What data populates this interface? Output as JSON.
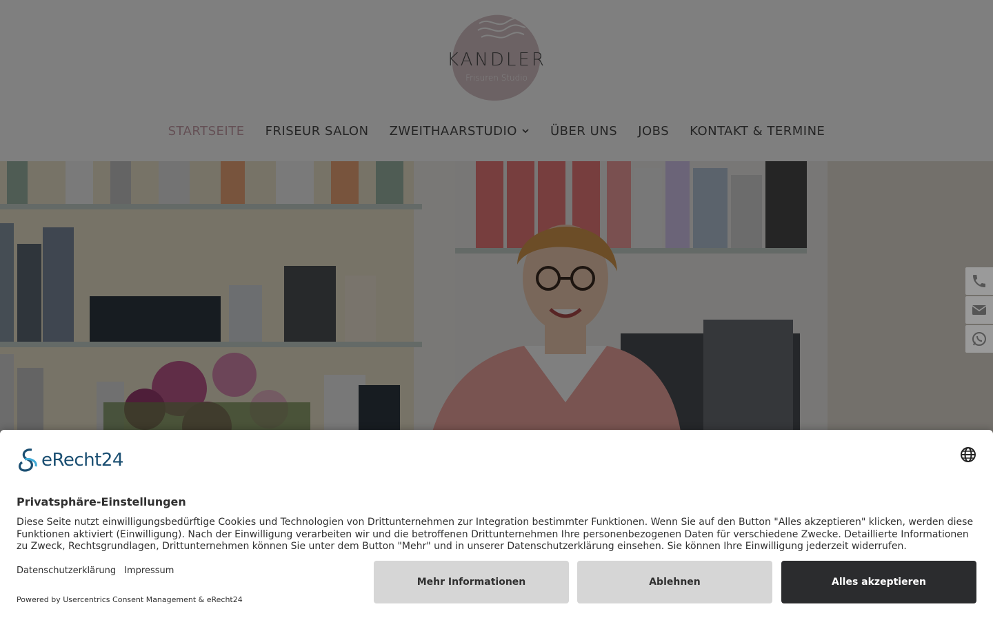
{
  "logo": {
    "name": "KANDLER",
    "subtitle": "Frisuren Studio"
  },
  "nav": {
    "items": [
      {
        "label": "STARTSEITE",
        "active": true
      },
      {
        "label": "FRISEUR SALON"
      },
      {
        "label": "ZWEITHAARSTUDIO",
        "has_dropdown": true
      },
      {
        "label": "ÜBER UNS"
      },
      {
        "label": "JOBS"
      },
      {
        "label": "KONTAKT & TERMINE"
      }
    ]
  },
  "side_contact": {
    "icons": [
      "phone-icon",
      "mail-icon",
      "whatsapp-icon"
    ]
  },
  "consent": {
    "brand": "eRecht24",
    "title": "Privatsphäre-Einstellungen",
    "text": "Diese Seite nutzt einwilligungsbedürftige Cookies und Technologien von Drittunternehmen zur Integration bestimmter Funktionen. Wenn Sie auf den Button \"Alles akzeptieren\" klicken, werden diese Funktionen aktiviert (Einwilligung). Nach der Einwilligung verarbeiten wir und die betroffenen Drittunternehmen Ihre personenbezogenen Daten für verschiedene Zwecke. Detaillierte Informationen zu Zweck, Rechtsgrundlagen, Drittunternehmen können Sie unter dem Button \"Mehr\" und in unserer Datenschutzerklärung einsehen. Sie können Ihre Einwilligung jederzeit widerrufen.",
    "link_privacy": "Datenschutzerklärung",
    "link_imprint": "Impressum",
    "powered": "Powered by Usercentrics Consent Management & eRecht24",
    "btn_more": "Mehr Informationen",
    "btn_deny": "Ablehnen",
    "btn_accept": "Alles akzeptieren"
  },
  "colors": {
    "nav_active": "#c9a0ab",
    "brand_blue": "#1b4f72",
    "accept_bg": "#2b2c2e"
  }
}
